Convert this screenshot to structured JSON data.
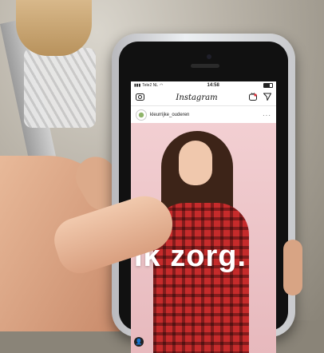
{
  "status_bar": {
    "carrier": "Tele2 NL",
    "time": "14:58"
  },
  "instagram": {
    "logo": "Instagram",
    "post": {
      "username": "kleurrijke_ouderen",
      "more": "···",
      "overlay_text": "Ik zorg."
    }
  },
  "colors": {
    "post_background": "#f2cfd2",
    "shirt": "#c62b2b",
    "overlay_text": "#ffffff"
  }
}
